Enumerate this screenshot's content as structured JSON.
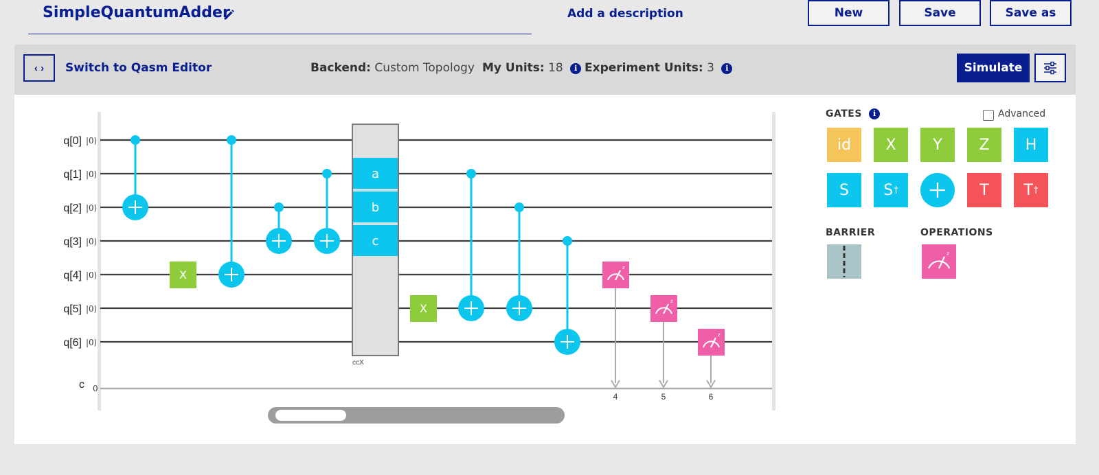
{
  "header": {
    "title": "SimpleQuantumAdder",
    "add_description": "Add a description",
    "buttons": {
      "new": "New",
      "save": "Save",
      "save_as": "Save as"
    }
  },
  "toolbar": {
    "code_toggle": "‹ ›",
    "switch_label": "Switch to Qasm Editor",
    "backend_label": "Backend:",
    "backend_value": "Custom Topology",
    "my_units_label": "My Units:",
    "my_units_value": "18",
    "experiment_units_label": "Experiment Units:",
    "experiment_units_value": "3",
    "info_glyph": "i",
    "simulate": "Simulate"
  },
  "circuit": {
    "qubits": [
      "q[0]",
      "q[1]",
      "q[2]",
      "q[3]",
      "q[4]",
      "q[5]",
      "q[6]"
    ],
    "init_state": "|0⟩",
    "classical_label": "c",
    "classical_init": "0",
    "ccx": {
      "labels": [
        "a",
        "b",
        "c"
      ],
      "name": "ccX"
    },
    "x_gate_label": "X",
    "measure_targets": [
      "4",
      "5",
      "6"
    ]
  },
  "palette": {
    "gates_title": "GATES",
    "advanced_label": "Advanced",
    "gates": [
      {
        "label": "id",
        "color": "#f5c45a"
      },
      {
        "label": "X",
        "color": "#8fcc3c"
      },
      {
        "label": "Y",
        "color": "#8fcc3c"
      },
      {
        "label": "Z",
        "color": "#8fcc3c"
      },
      {
        "label": "H",
        "color": "#0cc6ee"
      },
      {
        "label": "S",
        "color": "#0cc6ee"
      },
      {
        "label": "S",
        "sup": "†",
        "color": "#0cc6ee"
      },
      {
        "label": "+",
        "color": "#0cc6ee",
        "shape": "circle"
      },
      {
        "label": "T",
        "color": "#f4535a"
      },
      {
        "label": "T",
        "sup": "†",
        "color": "#f4535a"
      }
    ],
    "barrier_title": "BARRIER",
    "operations_title": "OPERATIONS"
  },
  "colors": {
    "brand": "#0a1f8f",
    "cnot": "#0cc6ee",
    "x_gate": "#8fcc3c",
    "measure": "#ef5fa7",
    "barrier": "#a9c4c6"
  }
}
